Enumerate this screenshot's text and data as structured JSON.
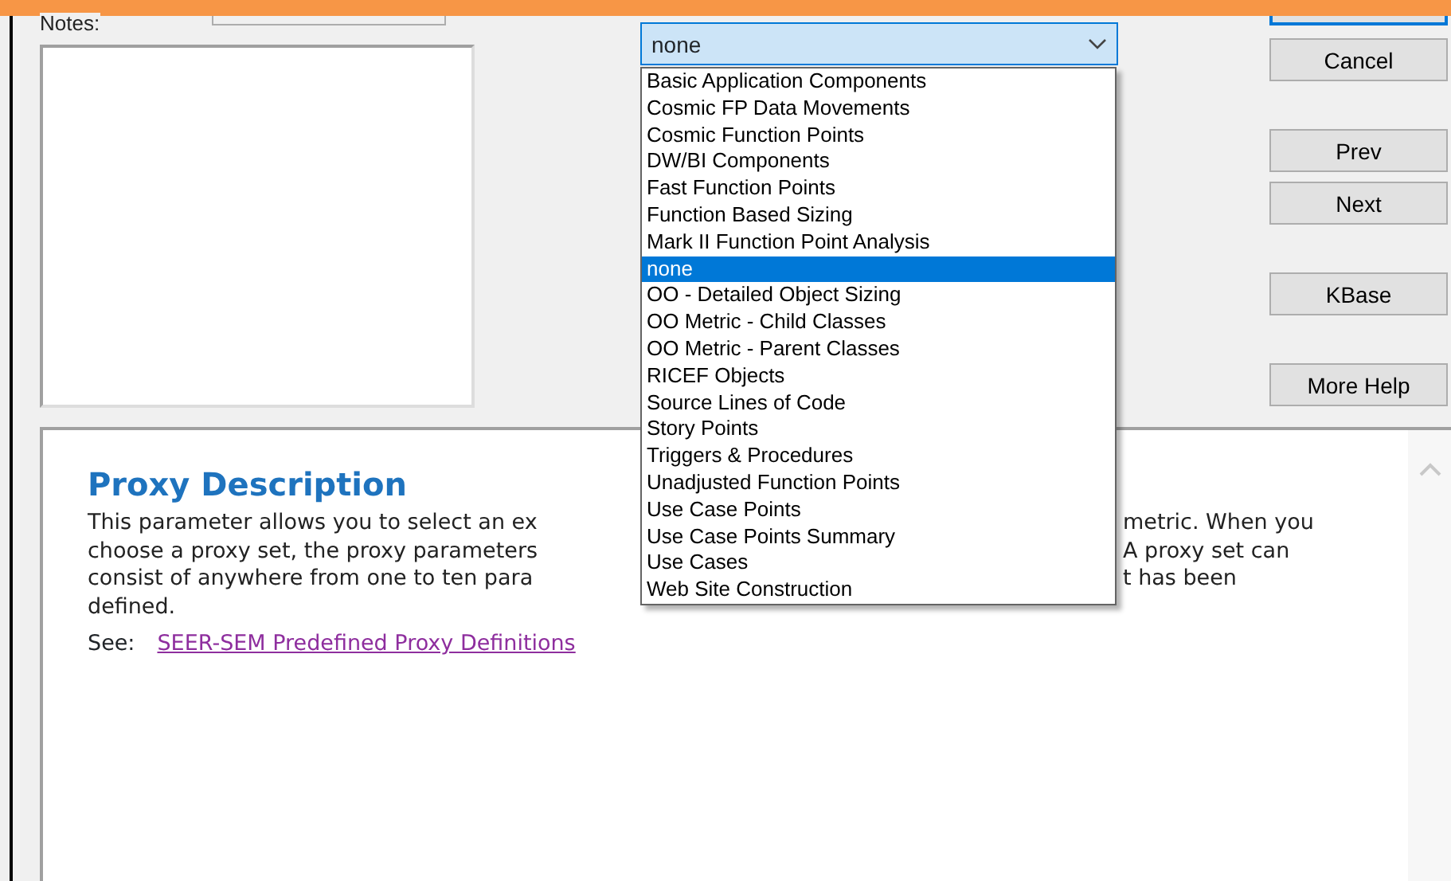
{
  "notes": {
    "label": "Notes:"
  },
  "proxy_combo": {
    "value": "none",
    "expanded": true,
    "options": [
      {
        "label": "Basic Application Components",
        "selected": false
      },
      {
        "label": "Cosmic FP Data Movements",
        "selected": false
      },
      {
        "label": "Cosmic Function Points",
        "selected": false
      },
      {
        "label": "DW/BI Components",
        "selected": false
      },
      {
        "label": "Fast Function Points",
        "selected": false
      },
      {
        "label": "Function Based Sizing",
        "selected": false
      },
      {
        "label": "Mark II Function Point Analysis",
        "selected": false
      },
      {
        "label": "none",
        "selected": true
      },
      {
        "label": "OO - Detailed Object Sizing",
        "selected": false
      },
      {
        "label": "OO Metric - Child Classes",
        "selected": false
      },
      {
        "label": "OO Metric - Parent Classes",
        "selected": false
      },
      {
        "label": "RICEF Objects",
        "selected": false
      },
      {
        "label": "Source Lines of Code",
        "selected": false
      },
      {
        "label": "Story Points",
        "selected": false
      },
      {
        "label": "Triggers & Procedures",
        "selected": false
      },
      {
        "label": "Unadjusted Function Points",
        "selected": false
      },
      {
        "label": "Use Case Points",
        "selected": false
      },
      {
        "label": "Use Case Points Summary",
        "selected": false
      },
      {
        "label": "Use Cases",
        "selected": false
      },
      {
        "label": "Web Site Construction",
        "selected": false
      }
    ]
  },
  "buttons": [
    {
      "label": "Cancel"
    },
    {
      "label": "Prev"
    },
    {
      "label": "Next"
    },
    {
      "label": "KBase"
    },
    {
      "label": "More Help"
    }
  ],
  "help": {
    "heading": "Proxy Description",
    "lines": [
      {
        "left": "This parameter allows you to select an ex",
        "right": "metric. When you"
      },
      {
        "left": "choose a proxy set, the proxy parameters",
        "right": "A proxy set can"
      },
      {
        "left": "consist of anywhere from one to ten para",
        "right": "t has been"
      },
      {
        "left": "defined."
      }
    ],
    "see_label": "See:",
    "link": "SEER-SEM Predefined Proxy Definitions"
  }
}
